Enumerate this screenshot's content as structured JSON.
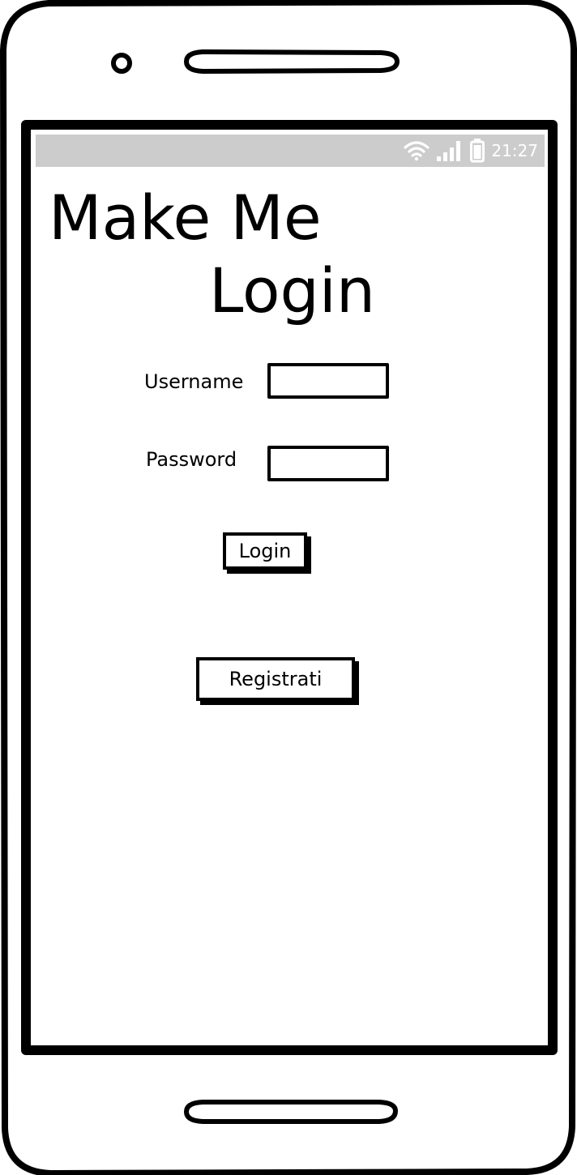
{
  "status_bar": {
    "time": "21:27",
    "wifi_icon": "wifi-icon",
    "signal_icon": "signal-icon",
    "battery_icon": "battery-icon",
    "background_color": "#cccccc"
  },
  "title": {
    "line1": "Make Me",
    "line2": "Login"
  },
  "form": {
    "username_label": "Username",
    "username_value": "",
    "password_label": "Password",
    "password_value": ""
  },
  "buttons": {
    "login_label": "Login",
    "register_label": "Registrati"
  }
}
